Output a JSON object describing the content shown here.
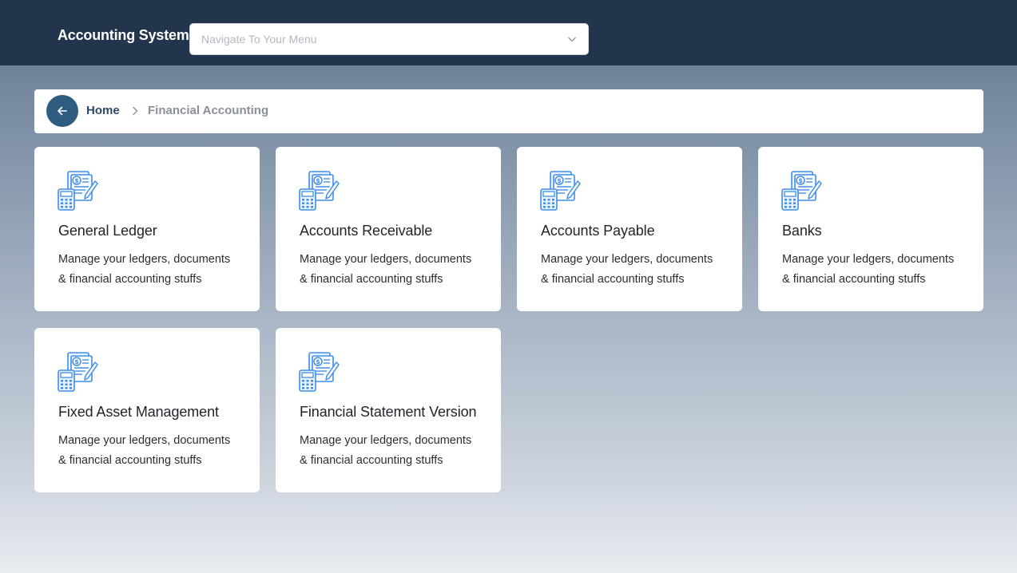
{
  "header": {
    "app_title": "Accounting System",
    "nav_placeholder": "Navigate To Your Menu"
  },
  "breadcrumb": {
    "home": "Home",
    "separator_icon": "chevron-right-icon",
    "current": "Financial Accounting"
  },
  "colors": {
    "header_bg": "#23354c",
    "back_button": "#2f5d82",
    "icon_blue": "#3f8ee8"
  },
  "cards": [
    {
      "title": "General Ledger",
      "desc_line1": "Manage your ledgers, documents",
      "desc_line2": "& financial accounting stuffs",
      "icon": "accounting-document-icon"
    },
    {
      "title": "Accounts Receivable",
      "desc_line1": "Manage your ledgers, documents",
      "desc_line2": "& financial accounting stuffs",
      "icon": "accounting-document-icon"
    },
    {
      "title": "Accounts Payable",
      "desc_line1": "Manage your ledgers, documents",
      "desc_line2": "& financial accounting stuffs",
      "icon": "accounting-document-icon"
    },
    {
      "title": "Banks",
      "desc_line1": "Manage your ledgers, documents",
      "desc_line2": "& financial accounting stuffs",
      "icon": "accounting-document-icon"
    },
    {
      "title": "Fixed Asset Management",
      "desc_line1": "Manage your ledgers, documents",
      "desc_line2": "& financial accounting stuffs",
      "icon": "accounting-document-icon"
    },
    {
      "title": "Financial Statement Version",
      "desc_line1": "Manage your ledgers, documents",
      "desc_line2": "& financial accounting stuffs",
      "icon": "accounting-document-icon"
    }
  ]
}
